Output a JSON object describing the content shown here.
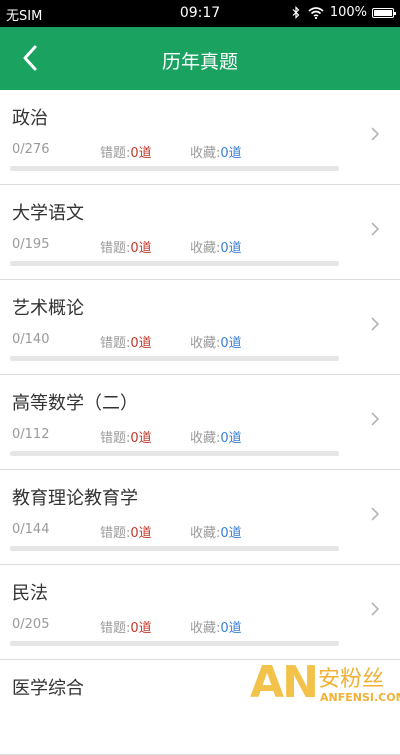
{
  "status_bar": {
    "carrier": "无SIM",
    "time": "09:17",
    "battery": "100%"
  },
  "nav": {
    "title": "历年真题",
    "back_icon": "chevron-left-icon"
  },
  "labels": {
    "wrong": "错题:",
    "favorite": "收藏:"
  },
  "items": [
    {
      "title": "政治",
      "progress": "0/276",
      "done": 0,
      "total": 276,
      "wrong": "0道",
      "favorite": "0道"
    },
    {
      "title": "大学语文",
      "progress": "0/195",
      "done": 0,
      "total": 195,
      "wrong": "0道",
      "favorite": "0道"
    },
    {
      "title": "艺术概论",
      "progress": "0/140",
      "done": 0,
      "total": 140,
      "wrong": "0道",
      "favorite": "0道"
    },
    {
      "title": "高等数学（二）",
      "progress": "0/112",
      "done": 0,
      "total": 112,
      "wrong": "0道",
      "favorite": "0道"
    },
    {
      "title": "教育理论教育学",
      "progress": "0/144",
      "done": 0,
      "total": 144,
      "wrong": "0道",
      "favorite": "0道"
    },
    {
      "title": "民法",
      "progress": "0/205",
      "done": 0,
      "total": 205,
      "wrong": "0道",
      "favorite": "0道"
    },
    {
      "title": "医学综合"
    }
  ],
  "watermark": {
    "logo_letters": "AN",
    "cn": "安粉丝",
    "en": "ANFENSI.COM"
  },
  "colors": {
    "accent": "#1aa260",
    "wrong": "#c0392b",
    "favorite": "#3a7fd5"
  }
}
